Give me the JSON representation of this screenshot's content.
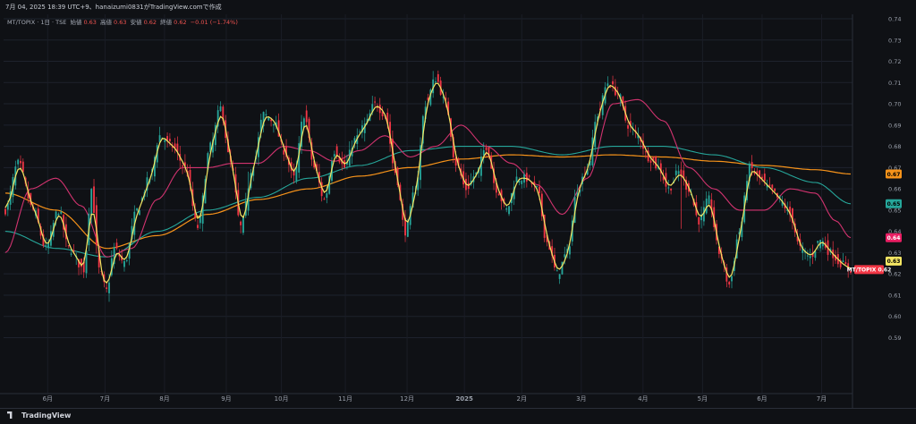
{
  "header": {
    "caption": "7月 04, 2025 18:39 UTC+9、hanaizumi0831がTradingView.comで作成"
  },
  "legend": {
    "symbol": "MT/TOPIX · 1日 · TSE",
    "open_label": "始値",
    "open": "0.63",
    "high_label": "高値",
    "high": "0.63",
    "low_label": "安値",
    "low": "0.62",
    "close_label": "終値",
    "close": "0.62",
    "change": "−0.01 (−1.74%)"
  },
  "footer": {
    "brand": "TradingView"
  },
  "colors": {
    "background": "#0f1115",
    "up": "#26a69a",
    "down": "#f23645",
    "ma5": "#f5e663",
    "ma25": "#d1336f",
    "ma75": "#26a69a",
    "ma200": "#f7931a"
  },
  "chart_data": {
    "type": "candlestick",
    "ylim": [
      0.57,
      0.74
    ],
    "y_ticks": [
      0.59,
      0.6,
      0.61,
      0.62,
      0.63,
      0.64,
      0.65,
      0.66,
      0.67,
      0.68,
      0.69,
      0.7,
      0.71,
      0.72,
      0.73,
      0.74
    ],
    "x_labels": [
      "6月",
      "7月",
      "8月",
      "9月",
      "10月",
      "11月",
      "12月",
      "2025",
      "2月",
      "3月",
      "4月",
      "5月",
      "6月",
      "7月"
    ],
    "grid": true,
    "price_badges": [
      {
        "label": "0.67",
        "value": 0.667,
        "color": "#f7931a",
        "text_color": "#000000"
      },
      {
        "label": "0.65",
        "value": 0.653,
        "color": "#26a69a",
        "text_color": "#000000"
      },
      {
        "label": "0.64",
        "value": 0.637,
        "color": "#e91e63",
        "text_color": "#ffffff"
      },
      {
        "label": "0.63",
        "value": 0.626,
        "color": "#f5e663",
        "text_color": "#000000"
      },
      {
        "label": "MT/TOPIX 0.62",
        "value": 0.622,
        "color": "#f23645",
        "text_color": "#ffffff"
      }
    ],
    "anchors_close": [
      [
        0,
        0.65
      ],
      [
        5,
        0.672
      ],
      [
        11,
        0.65
      ],
      [
        16,
        0.632
      ],
      [
        21,
        0.65
      ],
      [
        25,
        0.632
      ],
      [
        31,
        0.622
      ],
      [
        34,
        0.66
      ],
      [
        37,
        0.622
      ],
      [
        40,
        0.612
      ],
      [
        43,
        0.632
      ],
      [
        47,
        0.625
      ],
      [
        52,
        0.65
      ],
      [
        57,
        0.665
      ],
      [
        61,
        0.685
      ],
      [
        66,
        0.68
      ],
      [
        71,
        0.67
      ],
      [
        76,
        0.642
      ],
      [
        81,
        0.68
      ],
      [
        85,
        0.698
      ],
      [
        89,
        0.672
      ],
      [
        93,
        0.642
      ],
      [
        98,
        0.672
      ],
      [
        102,
        0.695
      ],
      [
        106,
        0.692
      ],
      [
        110,
        0.678
      ],
      [
        114,
        0.665
      ],
      [
        118,
        0.695
      ],
      [
        122,
        0.67
      ],
      [
        126,
        0.655
      ],
      [
        130,
        0.678
      ],
      [
        134,
        0.67
      ],
      [
        138,
        0.683
      ],
      [
        142,
        0.69
      ],
      [
        146,
        0.7
      ],
      [
        150,
        0.695
      ],
      [
        154,
        0.668
      ],
      [
        158,
        0.64
      ],
      [
        162,
        0.66
      ],
      [
        166,
        0.7
      ],
      [
        170,
        0.712
      ],
      [
        174,
        0.7
      ],
      [
        178,
        0.672
      ],
      [
        182,
        0.66
      ],
      [
        186,
        0.667
      ],
      [
        190,
        0.68
      ],
      [
        194,
        0.66
      ],
      [
        198,
        0.65
      ],
      [
        202,
        0.665
      ],
      [
        206,
        0.665
      ],
      [
        210,
        0.66
      ],
      [
        214,
        0.635
      ],
      [
        218,
        0.62
      ],
      [
        222,
        0.63
      ],
      [
        226,
        0.66
      ],
      [
        230,
        0.67
      ],
      [
        234,
        0.695
      ],
      [
        238,
        0.71
      ],
      [
        242,
        0.705
      ],
      [
        246,
        0.69
      ],
      [
        250,
        0.685
      ],
      [
        254,
        0.675
      ],
      [
        258,
        0.67
      ],
      [
        262,
        0.66
      ],
      [
        266,
        0.668
      ],
      [
        270,
        0.66
      ],
      [
        274,
        0.645
      ],
      [
        278,
        0.655
      ],
      [
        282,
        0.63
      ],
      [
        286,
        0.615
      ],
      [
        290,
        0.64
      ],
      [
        294,
        0.67
      ],
      [
        298,
        0.665
      ],
      [
        302,
        0.66
      ],
      [
        306,
        0.655
      ],
      [
        310,
        0.648
      ],
      [
        314,
        0.632
      ],
      [
        318,
        0.628
      ],
      [
        322,
        0.636
      ],
      [
        326,
        0.63
      ],
      [
        330,
        0.625
      ],
      [
        334,
        0.622
      ]
    ],
    "anchors_ma25": [
      [
        0,
        0.63
      ],
      [
        10,
        0.66
      ],
      [
        20,
        0.665
      ],
      [
        30,
        0.652
      ],
      [
        40,
        0.628
      ],
      [
        50,
        0.632
      ],
      [
        60,
        0.655
      ],
      [
        70,
        0.67
      ],
      [
        80,
        0.67
      ],
      [
        90,
        0.672
      ],
      [
        100,
        0.672
      ],
      [
        110,
        0.68
      ],
      [
        120,
        0.678
      ],
      [
        130,
        0.673
      ],
      [
        140,
        0.678
      ],
      [
        150,
        0.685
      ],
      [
        160,
        0.675
      ],
      [
        170,
        0.68
      ],
      [
        180,
        0.69
      ],
      [
        190,
        0.68
      ],
      [
        200,
        0.672
      ],
      [
        210,
        0.662
      ],
      [
        220,
        0.648
      ],
      [
        230,
        0.665
      ],
      [
        240,
        0.7
      ],
      [
        250,
        0.702
      ],
      [
        260,
        0.692
      ],
      [
        270,
        0.67
      ],
      [
        280,
        0.66
      ],
      [
        290,
        0.65
      ],
      [
        300,
        0.65
      ],
      [
        310,
        0.66
      ],
      [
        320,
        0.658
      ],
      [
        328,
        0.645
      ],
      [
        334,
        0.637
      ]
    ],
    "anchors_ma75": [
      [
        0,
        0.64
      ],
      [
        20,
        0.632
      ],
      [
        40,
        0.628
      ],
      [
        60,
        0.64
      ],
      [
        80,
        0.65
      ],
      [
        100,
        0.656
      ],
      [
        120,
        0.665
      ],
      [
        140,
        0.671
      ],
      [
        160,
        0.678
      ],
      [
        180,
        0.68
      ],
      [
        200,
        0.68
      ],
      [
        220,
        0.676
      ],
      [
        240,
        0.68
      ],
      [
        260,
        0.68
      ],
      [
        280,
        0.676
      ],
      [
        300,
        0.67
      ],
      [
        320,
        0.663
      ],
      [
        334,
        0.653
      ]
    ],
    "anchors_ma200": [
      [
        0,
        0.658
      ],
      [
        20,
        0.65
      ],
      [
        40,
        0.632
      ],
      [
        60,
        0.638
      ],
      [
        80,
        0.648
      ],
      [
        100,
        0.655
      ],
      [
        120,
        0.66
      ],
      [
        140,
        0.666
      ],
      [
        160,
        0.67
      ],
      [
        180,
        0.674
      ],
      [
        200,
        0.676
      ],
      [
        220,
        0.675
      ],
      [
        240,
        0.676
      ],
      [
        260,
        0.675
      ],
      [
        280,
        0.673
      ],
      [
        300,
        0.671
      ],
      [
        320,
        0.669
      ],
      [
        334,
        0.667
      ]
    ],
    "series": [
      {
        "name": "Candles",
        "color_up": "#26a69a",
        "color_down": "#f23645"
      },
      {
        "name": "MA5",
        "color": "#f5e663"
      },
      {
        "name": "MA25",
        "color": "#d1336f"
      },
      {
        "name": "MA75",
        "color": "#26a69a"
      },
      {
        "name": "MA200",
        "color": "#f7931a"
      }
    ]
  }
}
